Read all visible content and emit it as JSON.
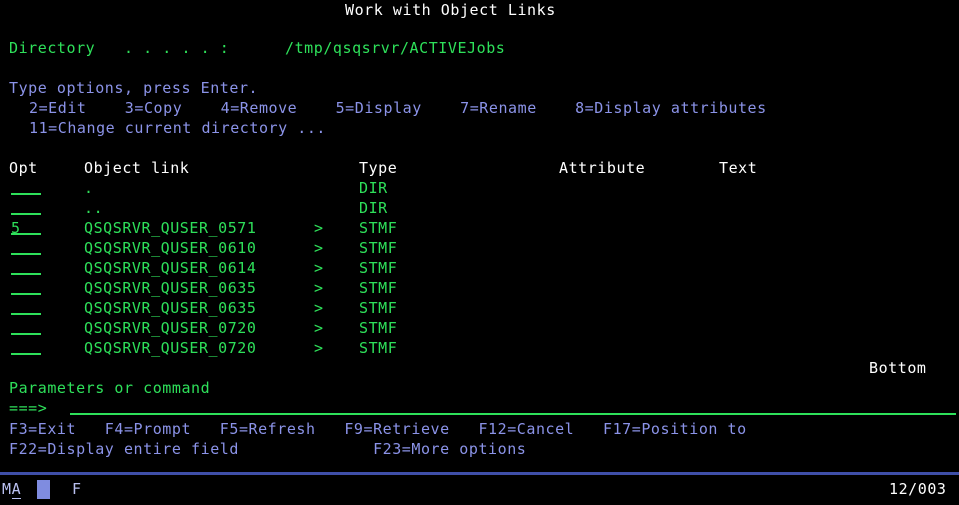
{
  "screen": {
    "title": "Work with Object Links",
    "directory_label": "Directory   . . . . . :",
    "directory_path": "/tmp/qsqsrvr/ACTIVEJobs",
    "instruction": "Type options, press Enter.",
    "options_line1": "2=Edit    3=Copy    4=Remove    5=Display    7=Rename    8=Display attributes",
    "options_line2": "11=Change current directory ...",
    "options": [
      {
        "code": "2",
        "label": "Edit"
      },
      {
        "code": "3",
        "label": "Copy"
      },
      {
        "code": "4",
        "label": "Remove"
      },
      {
        "code": "5",
        "label": "Display"
      },
      {
        "code": "7",
        "label": "Rename"
      },
      {
        "code": "8",
        "label": "Display attributes"
      },
      {
        "code": "11",
        "label": "Change current directory ..."
      }
    ],
    "columns": {
      "opt": "Opt",
      "object_link": "Object link",
      "type": "Type",
      "attribute": "Attribute",
      "text": "Text"
    },
    "rows": [
      {
        "opt": "",
        "object_link": ".",
        "more": "",
        "type": "DIR",
        "attribute": "",
        "text": ""
      },
      {
        "opt": "",
        "object_link": "..",
        "more": "",
        "type": "DIR",
        "attribute": "",
        "text": ""
      },
      {
        "opt": "5",
        "object_link": "QSQSRVR_QUSER_0571",
        "more": ">",
        "type": "STMF",
        "attribute": "",
        "text": ""
      },
      {
        "opt": "",
        "object_link": "QSQSRVR_QUSER_0610",
        "more": ">",
        "type": "STMF",
        "attribute": "",
        "text": ""
      },
      {
        "opt": "",
        "object_link": "QSQSRVR_QUSER_0614",
        "more": ">",
        "type": "STMF",
        "attribute": "",
        "text": ""
      },
      {
        "opt": "",
        "object_link": "QSQSRVR_QUSER_0635",
        "more": ">",
        "type": "STMF",
        "attribute": "",
        "text": ""
      },
      {
        "opt": "",
        "object_link": "QSQSRVR_QUSER_0635",
        "more": ">",
        "type": "STMF",
        "attribute": "",
        "text": ""
      },
      {
        "opt": "",
        "object_link": "QSQSRVR_QUSER_0720",
        "more": ">",
        "type": "STMF",
        "attribute": "",
        "text": ""
      },
      {
        "opt": "",
        "object_link": "QSQSRVR_QUSER_0720",
        "more": ">",
        "type": "STMF",
        "attribute": "",
        "text": ""
      }
    ],
    "scroll_indicator": "Bottom",
    "command_label": "Parameters or command",
    "command_prompt": "===>",
    "command_value": "",
    "function_keys_line1": "F3=Exit   F4=Prompt   F5=Refresh   F9=Retrieve   F12=Cancel   F17=Position to",
    "function_keys_line2": "F22=Display entire field              F23=More options",
    "function_keys": [
      {
        "key": "F3",
        "label": "Exit"
      },
      {
        "key": "F4",
        "label": "Prompt"
      },
      {
        "key": "F5",
        "label": "Refresh"
      },
      {
        "key": "F9",
        "label": "Retrieve"
      },
      {
        "key": "F12",
        "label": "Cancel"
      },
      {
        "key": "F17",
        "label": "Position to"
      },
      {
        "key": "F22",
        "label": "Display entire field"
      },
      {
        "key": "F23",
        "label": "More options"
      }
    ],
    "status": {
      "mode": "MA",
      "insert_indicator": "F",
      "cursor_position": "12/003"
    },
    "colors": {
      "background": "#000000",
      "white": "#ffffff",
      "green": "#2ee05a",
      "blue": "#8b93e8",
      "status_bar_line": "#3f4fa8",
      "cursor_block": "#7f8ce0"
    }
  }
}
